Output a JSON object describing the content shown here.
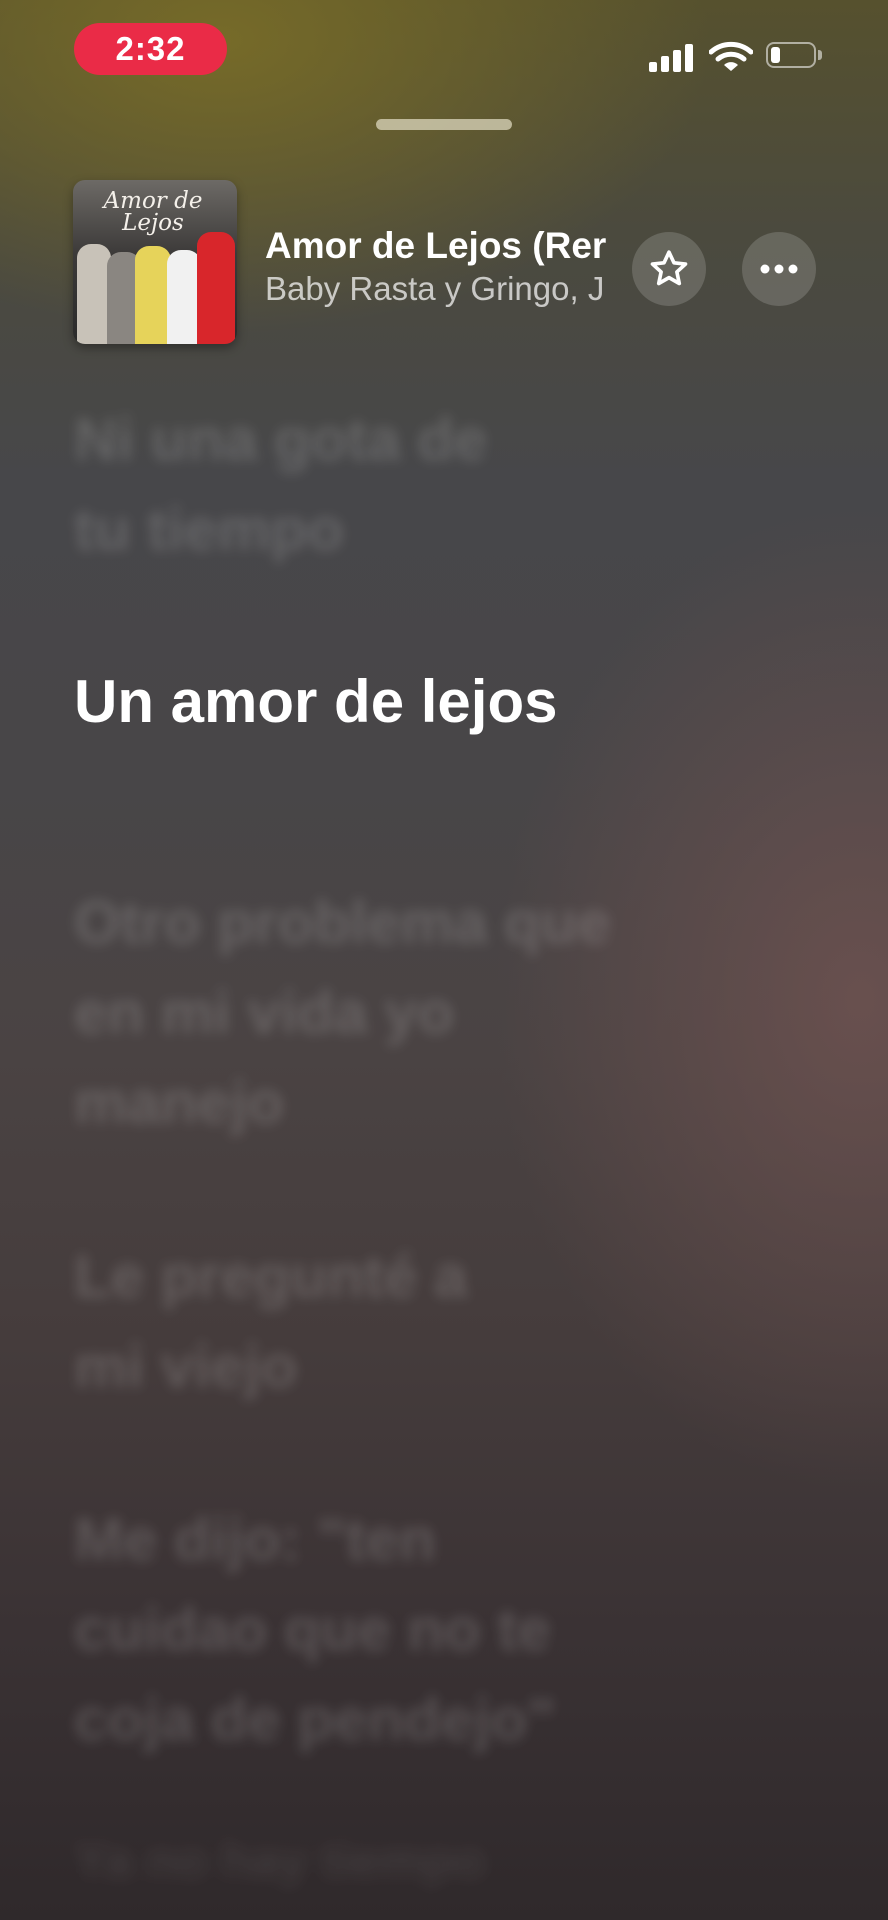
{
  "status_bar": {
    "time": "2:32",
    "time_pill_color": "#ea2b47",
    "icons": [
      "cellular-signal-icon",
      "wifi-icon",
      "battery-icon"
    ]
  },
  "now_playing": {
    "artwork_text": "Amor de Lejos",
    "title": "Amor de Lejos (Rer",
    "artist": "Baby Rasta y Gringo, J",
    "buttons": [
      "star-icon",
      "more-icon"
    ]
  },
  "lyrics": [
    {
      "text": "Ni una gota de\ntu tiempo",
      "active": false
    },
    {
      "text": "Un amor de lejos",
      "active": true
    },
    {
      "text": "Otro problema que\nen mi vida yo\nmanejo",
      "active": false
    },
    {
      "text": "Le pregunté a\nmi viejo",
      "active": false
    },
    {
      "text": "Me dijo: \"ten\ncuidao que no te\ncoja de pendejo\"",
      "active": false
    },
    {
      "text": "Ya no hay tiempo",
      "active": false
    }
  ]
}
